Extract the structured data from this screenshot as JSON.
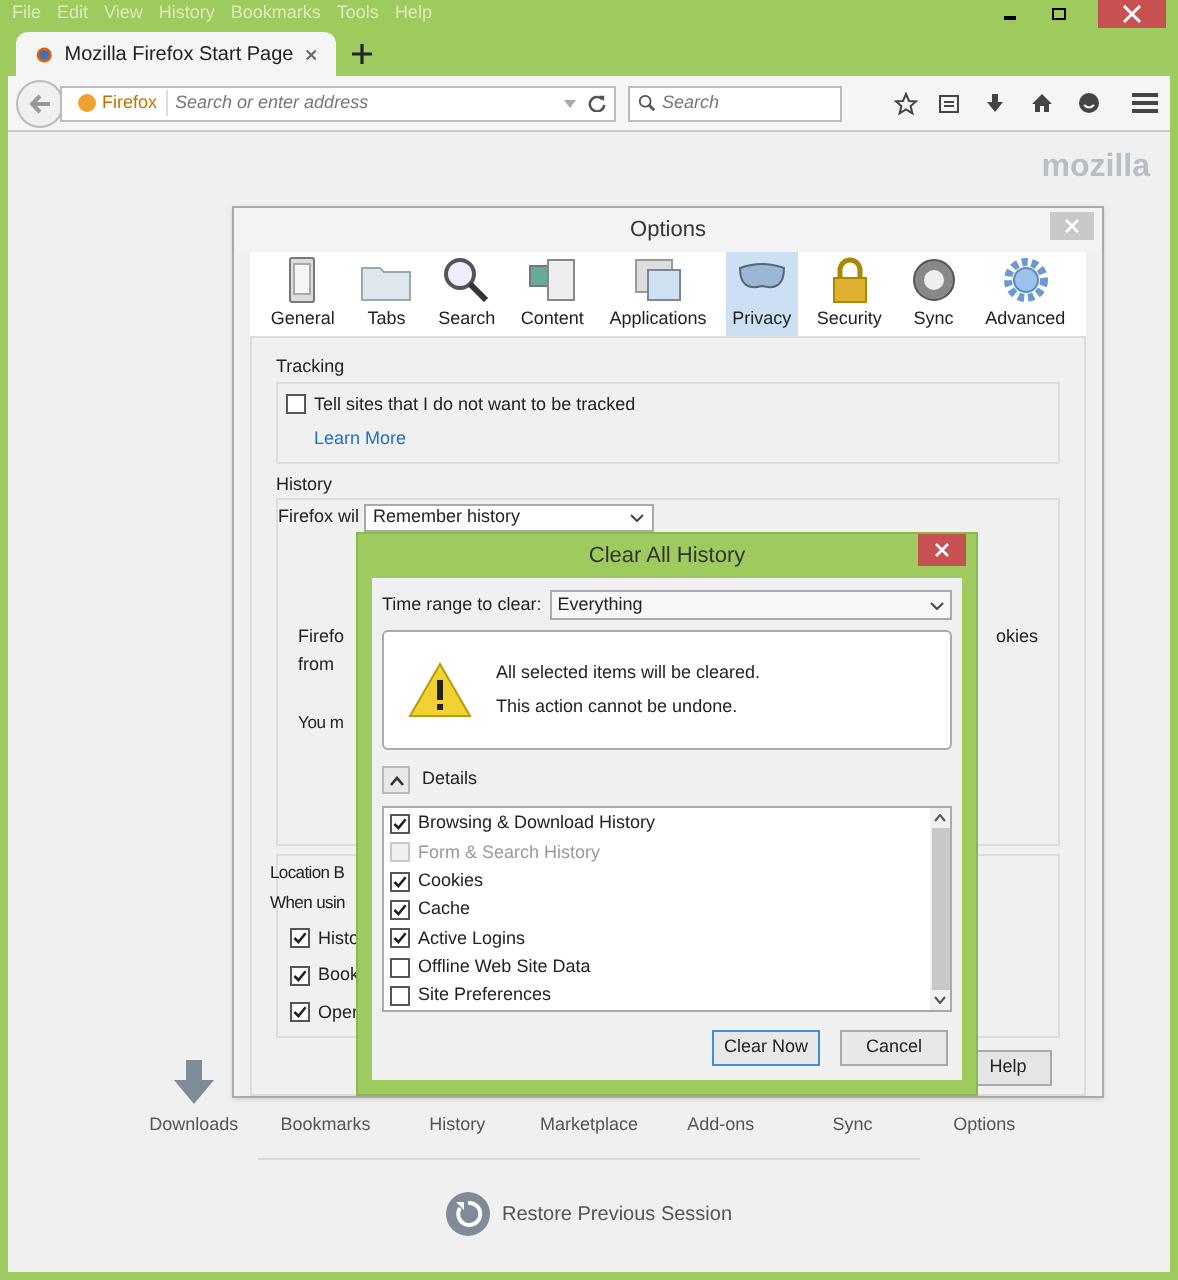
{
  "menu": [
    "File",
    "Edit",
    "View",
    "History",
    "Bookmarks",
    "Tools",
    "Help"
  ],
  "tab": {
    "title": "Mozilla Firefox Start Page"
  },
  "address_bar": {
    "identity": "Firefox",
    "placeholder": "Search or enter address"
  },
  "search_bar": {
    "placeholder": "Search"
  },
  "logo": "mozilla",
  "options": {
    "title": "Options",
    "tabs": [
      {
        "label": "General",
        "selected": false
      },
      {
        "label": "Tabs",
        "selected": false
      },
      {
        "label": "Search",
        "selected": false
      },
      {
        "label": "Content",
        "selected": false
      },
      {
        "label": "Applications",
        "selected": false
      },
      {
        "label": "Privacy",
        "selected": true
      },
      {
        "label": "Security",
        "selected": false
      },
      {
        "label": "Sync",
        "selected": false
      },
      {
        "label": "Advanced",
        "selected": false
      }
    ],
    "tracking": {
      "title": "Tracking",
      "checkbox": {
        "label": "Tell sites that I do not want to be tracked",
        "checked": false
      },
      "link": "Learn More"
    },
    "history": {
      "title": "History",
      "label": "Firefox wil",
      "select_value": "Remember history",
      "fragment_1": "Firefo",
      "fragment_2": "from",
      "fragment_3": "You m",
      "fragment_right": "okies"
    },
    "location_bar": {
      "title": "Location B",
      "label": "When usin",
      "checkboxes": [
        {
          "label": "Histo",
          "checked": true
        },
        {
          "label": "Book",
          "checked": true
        },
        {
          "label": "Oper",
          "checked": true
        }
      ]
    },
    "help_button": "Help"
  },
  "clear_dialog": {
    "title": "Clear All History",
    "time_range_label": "Time range to clear:",
    "time_range_value": "Everything",
    "warning_lines": [
      "All selected items will be cleared.",
      "This action cannot be undone."
    ],
    "details_label": "Details",
    "details_expanded": true,
    "items": [
      {
        "label": "Browsing & Download History",
        "checked": true,
        "disabled": false
      },
      {
        "label": "Form & Search History",
        "checked": false,
        "disabled": true
      },
      {
        "label": "Cookies",
        "checked": true,
        "disabled": false
      },
      {
        "label": "Cache",
        "checked": true,
        "disabled": false
      },
      {
        "label": "Active Logins",
        "checked": true,
        "disabled": false
      },
      {
        "label": "Offline Web Site Data",
        "checked": false,
        "disabled": false
      },
      {
        "label": "Site Preferences",
        "checked": false,
        "disabled": false
      }
    ],
    "buttons": [
      "Clear Now",
      "Cancel"
    ]
  },
  "launcher": [
    "Downloads",
    "Bookmarks",
    "History",
    "Marketplace",
    "Add-ons",
    "Sync",
    "Options"
  ],
  "restore": "Restore Previous Session"
}
